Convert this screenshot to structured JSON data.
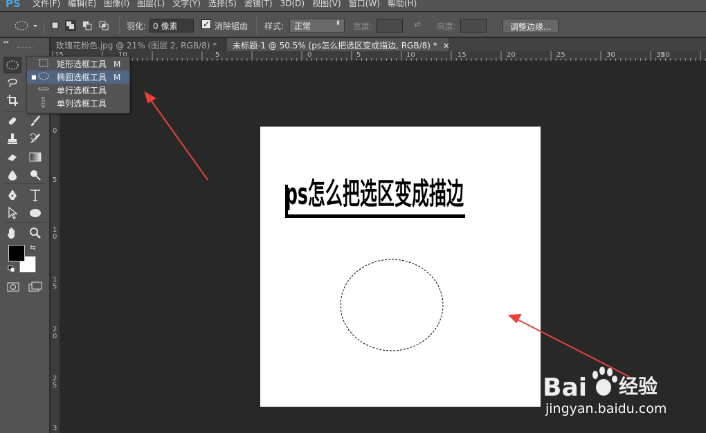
{
  "app": {
    "logo": "PS",
    "menu": [
      "文件(F)",
      "编辑(E)",
      "图像(I)",
      "图层(L)",
      "文字(Y)",
      "选择(S)",
      "滤镜(T)",
      "3D(D)",
      "视图(V)",
      "窗口(W)",
      "帮助(H)"
    ]
  },
  "options": {
    "feather_label": "羽化:",
    "feather_value": "0 像素",
    "antialias_label": "消除锯齿",
    "antialias_checked": true,
    "style_label": "样式:",
    "style_value": "正常",
    "width_label": "宽度:",
    "height_label": "高度:",
    "refine_edge_button": "调整边缘..."
  },
  "tabs": [
    {
      "label": "玫瑰花粉色.jpg @ 21% (图层 2, RGB/8) *",
      "active": false
    },
    {
      "label": "未标题-1 @ 50.5% (ps怎么把选区变成描边, RGB/8) *",
      "active": true
    }
  ],
  "ruler_top": [
    "15",
    "10",
    "5",
    "0",
    "5",
    "10",
    "15",
    "20",
    "25",
    "30",
    "35",
    "40"
  ],
  "ruler_left": [
    "0",
    "5",
    "1\n0",
    "1\n5",
    "2\n0",
    "2\n5",
    "3"
  ],
  "flyout": {
    "items": [
      {
        "label": "矩形选框工具",
        "key": "M",
        "icon": "rect-marquee-icon",
        "selected": false
      },
      {
        "label": "椭圆选框工具",
        "key": "M",
        "icon": "ellipse-marquee-icon",
        "selected": true
      },
      {
        "label": "单行选框工具",
        "key": "",
        "icon": "single-row-marquee-icon",
        "selected": false
      },
      {
        "label": "单列选框工具",
        "key": "",
        "icon": "single-column-marquee-icon",
        "selected": false
      }
    ]
  },
  "canvas": {
    "title_text": "ps怎么把选区变成描边",
    "selection_shape": "ellipse"
  },
  "watermark": {
    "brand": "Bai",
    "brand2": "经验",
    "url": "jingyan.baidu.com"
  },
  "colors": {
    "accent_highlight": "#4f6582",
    "arrow": "#e8423a",
    "foreground": "#000000",
    "background": "#ffffff"
  }
}
